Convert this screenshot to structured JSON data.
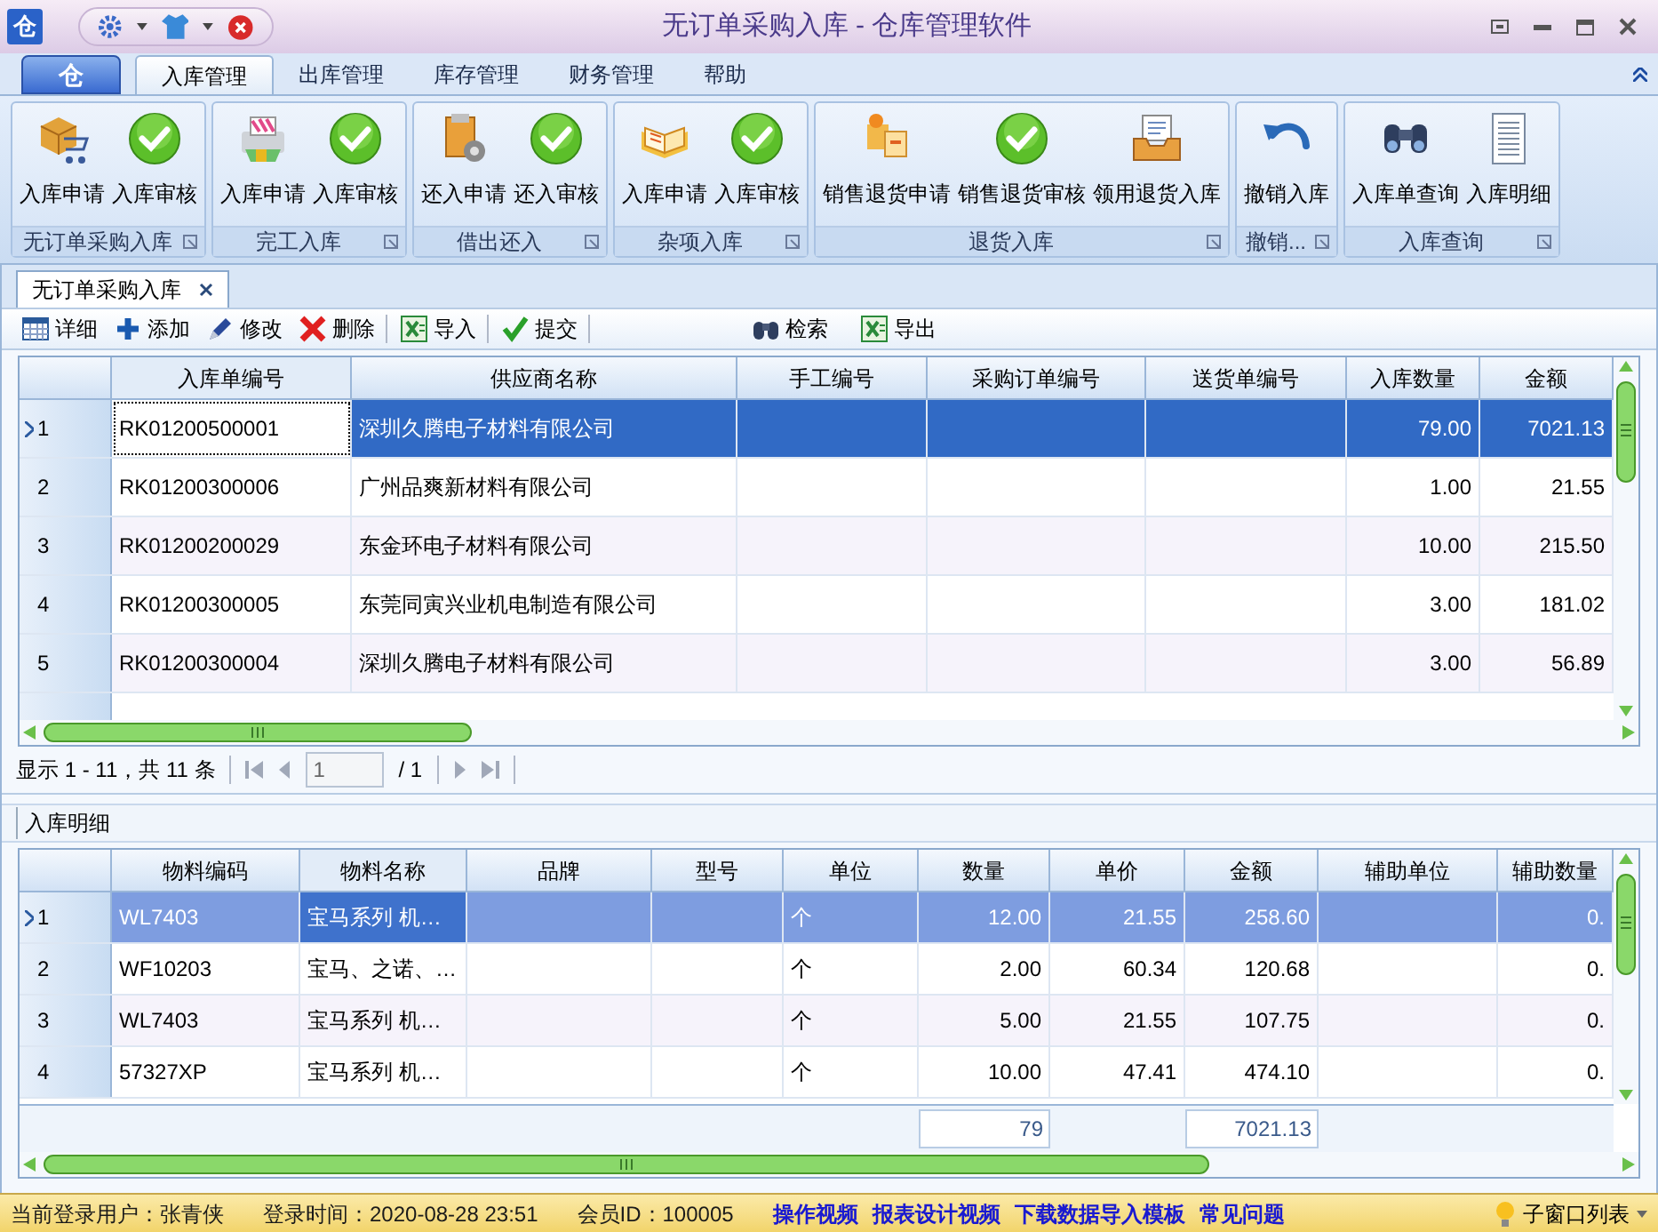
{
  "window": {
    "logo": "仓",
    "title": "无订单采购入库 - 仓库管理软件"
  },
  "ribbon": {
    "app_button": "仓",
    "tabs": [
      {
        "label": "入库管理",
        "selected": true
      },
      {
        "label": "出库管理",
        "selected": false
      },
      {
        "label": "库存管理",
        "selected": false
      },
      {
        "label": "财务管理",
        "selected": false
      },
      {
        "label": "帮助",
        "selected": false
      }
    ],
    "groups": [
      {
        "label": "无订单采购入库",
        "buttons": [
          {
            "label": "入库申请",
            "kind": "box"
          },
          {
            "label": "入库审核",
            "kind": "check"
          }
        ]
      },
      {
        "label": "完工入库",
        "buttons": [
          {
            "label": "入库申请",
            "kind": "printer"
          },
          {
            "label": "入库审核",
            "kind": "check"
          }
        ]
      },
      {
        "label": "借出还入",
        "buttons": [
          {
            "label": "还入申请",
            "kind": "docgear"
          },
          {
            "label": "还入审核",
            "kind": "check"
          }
        ]
      },
      {
        "label": "杂项入库",
        "buttons": [
          {
            "label": "入库申请",
            "kind": "book"
          },
          {
            "label": "入库审核",
            "kind": "check"
          }
        ]
      },
      {
        "label": "退货入库",
        "buttons": [
          {
            "label": "销售退货申请",
            "kind": "boxes"
          },
          {
            "label": "销售退货审核",
            "kind": "check"
          },
          {
            "label": "领用退货入库",
            "kind": "tray"
          }
        ]
      },
      {
        "label": "撤销...",
        "buttons": [
          {
            "label": "撤销入库",
            "kind": "undo"
          }
        ]
      },
      {
        "label": "入库查询",
        "buttons": [
          {
            "label": "入库单查询",
            "kind": "binoculars"
          },
          {
            "label": "入库明细",
            "kind": "page"
          }
        ]
      }
    ]
  },
  "document_tab": {
    "label": "无订单采购入库"
  },
  "toolbar": {
    "left": [
      {
        "label": "详细",
        "kind": "grid"
      },
      {
        "label": "添加",
        "kind": "plus"
      },
      {
        "label": "修改",
        "kind": "pen"
      },
      {
        "label": "删除",
        "kind": "cross"
      },
      {
        "label": "导入",
        "kind": "excel"
      },
      {
        "label": "提交",
        "kind": "tick"
      }
    ],
    "right": [
      {
        "label": "检索",
        "kind": "binoculars"
      },
      {
        "label": "导出",
        "kind": "excel"
      }
    ]
  },
  "grid": {
    "columns": [
      {
        "label": "入库单编号",
        "kind": "text",
        "focused": true
      },
      {
        "label": "供应商名称",
        "kind": "text",
        "focused": false
      },
      {
        "label": "手工编号",
        "kind": "text",
        "focused": false
      },
      {
        "label": "采购订单编号",
        "kind": "text",
        "focused": false
      },
      {
        "label": "送货单编号",
        "kind": "text",
        "focused": false
      },
      {
        "label": "入库数量",
        "kind": "number",
        "focused": false
      },
      {
        "label": "金额",
        "kind": "number",
        "focused": false
      }
    ],
    "rows": [
      {
        "index": "1",
        "selected": true,
        "cells": [
          "RK01200500001",
          "深圳久腾电子材料有限公司",
          "",
          "",
          "",
          "79.00",
          "7021.13"
        ]
      },
      {
        "index": "2",
        "selected": false,
        "cells": [
          "RK01200300006",
          "广州品爽新材料有限公司",
          "",
          "",
          "",
          "1.00",
          "21.55"
        ]
      },
      {
        "index": "3",
        "selected": false,
        "cells": [
          "RK01200200029",
          "东金环电子材料有限公司",
          "",
          "",
          "",
          "10.00",
          "215.50"
        ]
      },
      {
        "index": "4",
        "selected": false,
        "cells": [
          "RK01200300005",
          "东莞同寅兴业机电制造有限公司",
          "",
          "",
          "",
          "3.00",
          "181.02"
        ]
      },
      {
        "index": "5",
        "selected": false,
        "cells": [
          "RK01200300004",
          "深圳久腾电子材料有限公司",
          "",
          "",
          "",
          "3.00",
          "56.89"
        ]
      }
    ]
  },
  "pager": {
    "summary": "显示 1 - 11，共 11 条",
    "page": "1",
    "page_count": "/ 1"
  },
  "detail": {
    "title": "入库明细",
    "columns": [
      {
        "label": "物料编码",
        "kind": "text",
        "focused": false
      },
      {
        "label": "物料名称",
        "kind": "text",
        "focused": true
      },
      {
        "label": "品牌",
        "kind": "text",
        "focused": false
      },
      {
        "label": "型号",
        "kind": "text",
        "focused": false
      },
      {
        "label": "单位",
        "kind": "text",
        "focused": false
      },
      {
        "label": "数量",
        "kind": "number",
        "focused": false
      },
      {
        "label": "单价",
        "kind": "number",
        "focused": false
      },
      {
        "label": "金额",
        "kind": "number",
        "focused": false
      },
      {
        "label": "辅助单位",
        "kind": "text",
        "focused": false
      },
      {
        "label": "辅助数量",
        "kind": "number",
        "focused": false
      }
    ],
    "rows": [
      {
        "index": "1",
        "selected": true,
        "cells": [
          "WL7403",
          "宝马系列 机…",
          "",
          "",
          "个",
          "12.00",
          "21.55",
          "258.60",
          "",
          "0."
        ]
      },
      {
        "index": "2",
        "selected": false,
        "cells": [
          "WF10203",
          "宝马、之诺、…",
          "",
          "",
          "个",
          "2.00",
          "60.34",
          "120.68",
          "",
          "0."
        ]
      },
      {
        "index": "3",
        "selected": false,
        "cells": [
          "WL7403",
          "宝马系列 机…",
          "",
          "",
          "个",
          "5.00",
          "21.55",
          "107.75",
          "",
          "0."
        ]
      },
      {
        "index": "4",
        "selected": false,
        "cells": [
          "57327XP",
          "宝马系列 机…",
          "",
          "",
          "个",
          "10.00",
          "47.41",
          "474.10",
          "",
          "0."
        ]
      }
    ],
    "totals": {
      "quantity": "79",
      "amount": "7021.13"
    }
  },
  "status_bar": {
    "fields": [
      "当前登录用户：张青侠",
      "登录时间：2020-08-28 23:51",
      "会员ID：100005"
    ],
    "links": [
      "操作视频",
      "报表设计视频",
      "下载数据导入模板",
      "常见问题"
    ],
    "window_list": "子窗口列表"
  }
}
